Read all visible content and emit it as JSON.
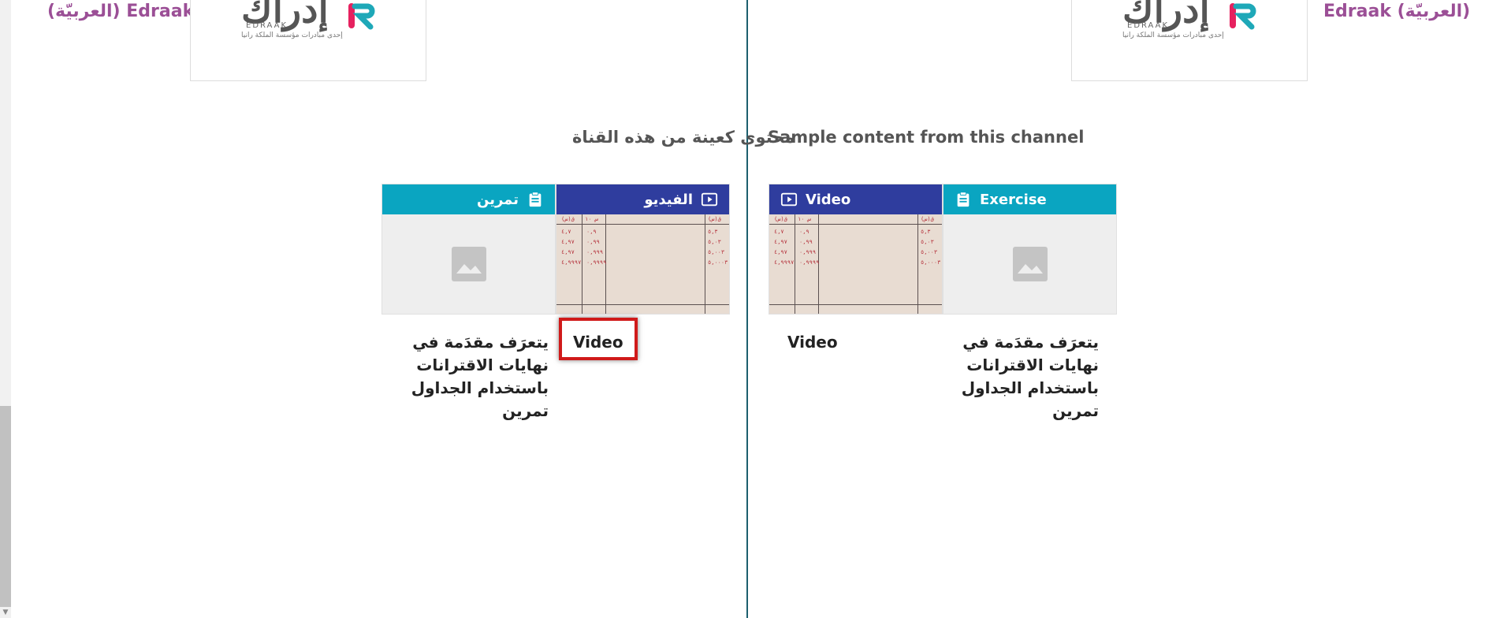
{
  "left_panel": {
    "channel_name": "Edraak (العربيّة)",
    "logo": {
      "word": "إدراك",
      "sub": "EDRAAK",
      "tagline": "إحدى مبادرات مؤسسة الملكة رانيا"
    },
    "section_title": "محتوى كعينة من هذه القناة",
    "cards": [
      {
        "kind_label": "الفيديو",
        "icon": "video-icon",
        "caption": "Video"
      },
      {
        "kind_label": "تمرين",
        "icon": "clipboard-icon",
        "caption_lines": [
          "يتعرَف مقدَمة في",
          "نهايات الاقترانات",
          "باستخدام الجداول",
          "تمرين"
        ]
      }
    ]
  },
  "right_panel": {
    "channel_name": "Edraak (العربيّة)",
    "logo": {
      "word": "إدراك",
      "sub": "EDRAAK",
      "tagline": "إحدى مبادرات مؤسسة الملكة رانيا"
    },
    "section_title": "Sample content from this channel",
    "cards": [
      {
        "kind_label": "Video",
        "icon": "video-icon",
        "caption": "Video"
      },
      {
        "kind_label": "Exercise",
        "icon": "clipboard-icon",
        "caption_lines": [
          "يتعرَف مقدَمة في",
          "نهايات الاقترانات",
          "باستخدام الجداول",
          "تمرين"
        ]
      }
    ]
  },
  "paper_numbers": {
    "header_a": "ق(س)",
    "header_b": "س ١٠",
    "col_a": [
      "٤,٧",
      "٤,٩٧",
      "٤,٩٧",
      "٤,٩٩٩٧"
    ],
    "col_b": [
      "٠,٩",
      "٠,٩٩",
      "٠,٩٩٩",
      "٠,٩٩٩٩"
    ],
    "col_c": [
      "٥,٣",
      "٥,٠٣",
      "٥,٠٠٣",
      "٥,٠٠٠٣"
    ]
  },
  "colors": {
    "video": "#2f3d9e",
    "exercise": "#0aa5c1",
    "channel": "#9b4f96",
    "highlight": "#d01a1a"
  }
}
